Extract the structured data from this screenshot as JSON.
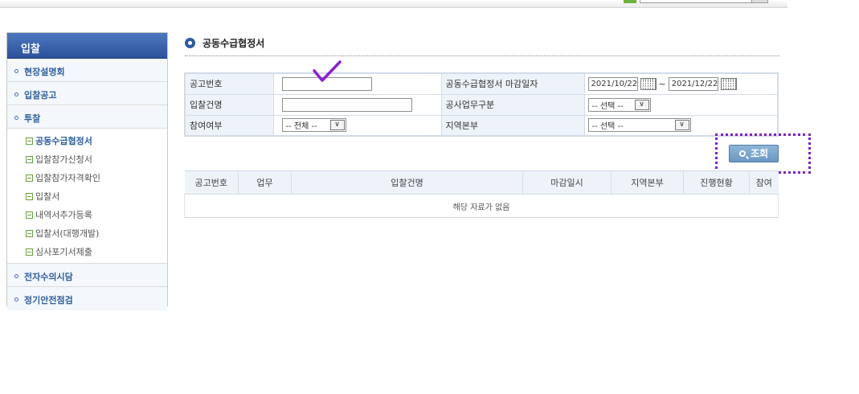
{
  "sidebar": {
    "title": "입찰",
    "items": [
      {
        "label": "현장설명회"
      },
      {
        "label": "입찰공고"
      },
      {
        "label": "투찰"
      }
    ],
    "sub_items": [
      {
        "label": "공동수급협정서"
      },
      {
        "label": "입찰참가신청서"
      },
      {
        "label": "입찰참가자격확인"
      },
      {
        "label": "입찰서"
      },
      {
        "label": "내역서추가등록"
      },
      {
        "label": "입찰서(대행개발)"
      },
      {
        "label": "심사포기서제출"
      }
    ],
    "items_after": [
      {
        "label": "전자수의시담"
      },
      {
        "label": "정기안전점검"
      }
    ]
  },
  "page": {
    "title": "공동수급협정서"
  },
  "form": {
    "notice_no_label": "공고번호",
    "notice_no_value": "",
    "deadline_label": "공동수급협정서 마감일자",
    "date_from": "2021/10/22",
    "date_sep": "~",
    "date_to": "2021/12/22",
    "bid_name_label": "입찰건명",
    "bid_name_value": "",
    "work_type_label": "공사업무구분",
    "work_type_value": "-- 선택 --",
    "participation_label": "참여여부",
    "participation_value": "-- 전체 --",
    "region_label": "지역본부",
    "region_value": "-- 선택 --"
  },
  "search_button": {
    "label": "조회"
  },
  "results": {
    "headers": [
      "공고번호",
      "업무",
      "입찰건명",
      "마감일시",
      "지역본부",
      "진행현황",
      "참여"
    ],
    "empty_message": "해당 자료가 없음"
  },
  "colors": {
    "sidebar_header": "#2b529a",
    "accent_blue": "#2e5f9e",
    "annotation_purple": "#7a1fd1",
    "button_blue": "#6b97c4"
  }
}
